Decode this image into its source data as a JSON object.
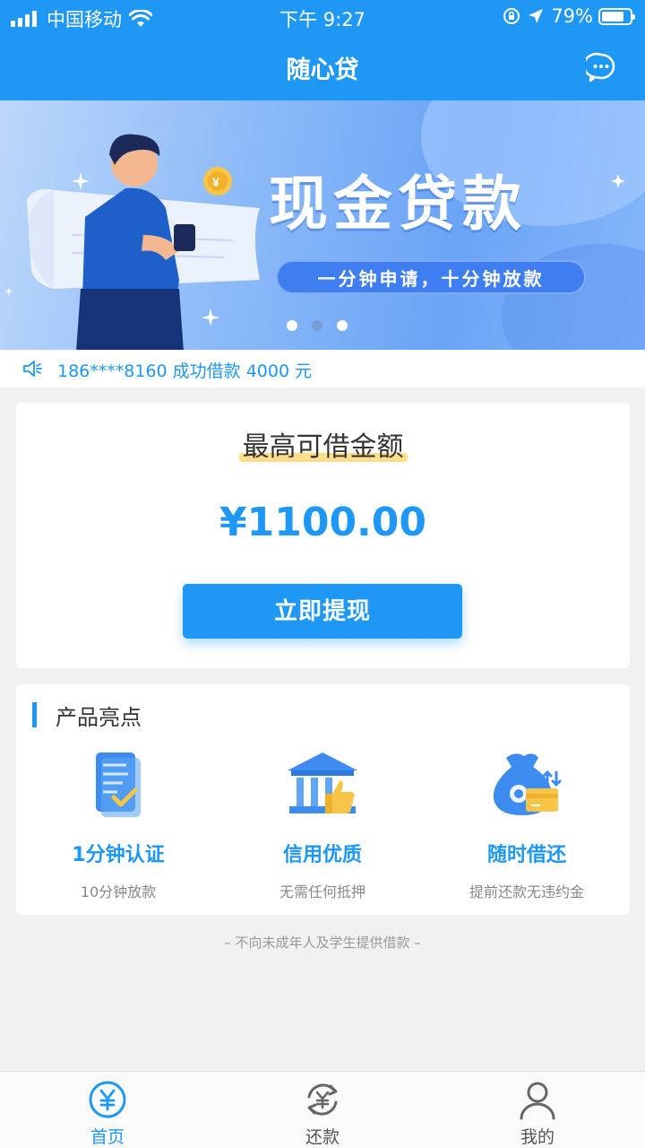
{
  "status_bar": {
    "carrier": "中国移动",
    "time": "下午 9:27",
    "battery": "79%",
    "battery_level": 0.79
  },
  "header": {
    "title": "随心贷",
    "chat_icon": "chat-bubble-icon"
  },
  "banner": {
    "title": "现金贷款",
    "subtitle": "一分钟申请，十分钟放款",
    "slides": 3,
    "active_slide": 2
  },
  "notice": {
    "icon": "speaker-icon",
    "text": "186****8160 成功借款 4000 元"
  },
  "loan": {
    "label": "最高可借金额",
    "amount": "¥1100.00",
    "button": "立即提现"
  },
  "highlights": {
    "title": "产品亮点",
    "items": [
      {
        "icon": "document-check-icon",
        "title": "1分钟认证",
        "subtitle": "10分钟放款"
      },
      {
        "icon": "bank-thumbs-up-icon",
        "title": "信用优质",
        "subtitle": "无需任何抵押"
      },
      {
        "icon": "money-bag-card-icon",
        "title": "随时借还",
        "subtitle": "提前还款无违约金"
      }
    ]
  },
  "footnote": "– 不向未成年人及学生提供借款 –",
  "tabs": [
    {
      "icon": "yen-circle-icon",
      "label": "首页",
      "active": true
    },
    {
      "icon": "refresh-yen-icon",
      "label": "还款",
      "active": false
    },
    {
      "icon": "user-icon",
      "label": "我的",
      "active": false
    }
  ],
  "colors": {
    "primary": "#1e97f5",
    "highlight": "#ffdf8a",
    "background": "#f1f1f1"
  }
}
